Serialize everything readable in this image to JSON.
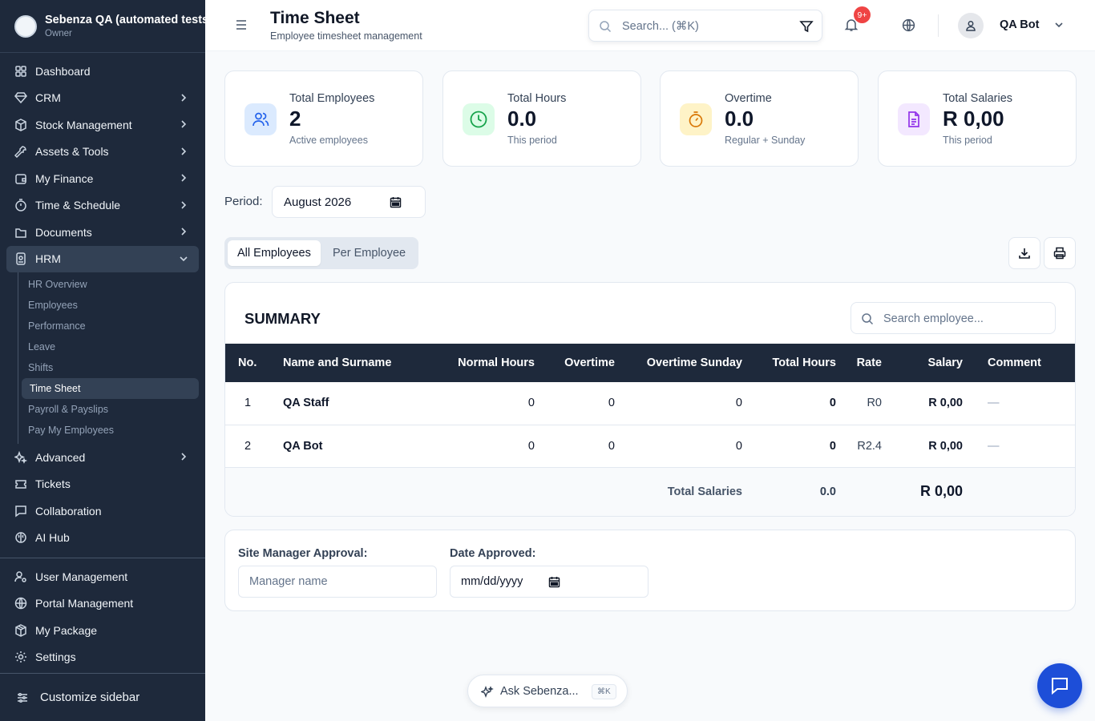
{
  "sidebar": {
    "org_name": "Sebenza QA (automated tests)",
    "role": "Owner",
    "items": [
      {
        "label": "Dashboard",
        "icon": "grid-icon",
        "expandable": false
      },
      {
        "label": "CRM",
        "icon": "gem-icon",
        "expandable": true
      },
      {
        "label": "Stock Management",
        "icon": "box-icon",
        "expandable": true
      },
      {
        "label": "Assets & Tools",
        "icon": "wrench-icon",
        "expandable": true
      },
      {
        "label": "My Finance",
        "icon": "wallet-icon",
        "expandable": true
      },
      {
        "label": "Time & Schedule",
        "icon": "timer-icon",
        "expandable": true
      },
      {
        "label": "Documents",
        "icon": "folder-icon",
        "expandable": true
      },
      {
        "label": "HRM",
        "icon": "id-card-icon",
        "expandable": true,
        "expanded": true
      }
    ],
    "hrm_subitems": [
      "HR Overview",
      "Employees",
      "Performance",
      "Leave",
      "Shifts",
      "Time Sheet",
      "Payroll & Payslips",
      "Pay My Employees"
    ],
    "active_subitem": "Time Sheet",
    "items_after": [
      {
        "label": "Advanced",
        "icon": "sparkles-icon",
        "expandable": true
      },
      {
        "label": "Tickets",
        "icon": "ticket-icon",
        "expandable": false
      },
      {
        "label": "Collaboration",
        "icon": "message-square-icon",
        "expandable": false
      },
      {
        "label": "AI Hub",
        "icon": "brain-icon",
        "expandable": false
      }
    ],
    "bottom_items": [
      {
        "label": "User Management",
        "icon": "user-cog-icon"
      },
      {
        "label": "Portal Management",
        "icon": "globe-icon"
      },
      {
        "label": "My Package",
        "icon": "package-icon"
      },
      {
        "label": "Settings",
        "icon": "gear-icon"
      }
    ],
    "customize_label": "Customize sidebar"
  },
  "header": {
    "title": "Time Sheet",
    "subtitle": "Employee timesheet management",
    "search_placeholder": "Search... (⌘K)",
    "notifications_badge": "9+",
    "user_name": "QA Bot"
  },
  "stats": [
    {
      "label": "Total Employees",
      "value": "2",
      "sub": "Active employees",
      "icon": "users-icon",
      "bg": "#dbeafe",
      "fg": "#2563eb"
    },
    {
      "label": "Total Hours",
      "value": "0.0",
      "sub": "This period",
      "icon": "clock-icon",
      "bg": "#dcfce7",
      "fg": "#16a34a"
    },
    {
      "label": "Overtime",
      "value": "0.0",
      "sub": "Regular + Sunday",
      "icon": "stopwatch-icon",
      "bg": "#fef3c7",
      "fg": "#d97706"
    },
    {
      "label": "Total Salaries",
      "value": "R 0,00",
      "sub": "This period",
      "icon": "document-icon",
      "bg": "#f3e8ff",
      "fg": "#9333ea"
    }
  ],
  "period": {
    "label": "Period:",
    "value": "August  2026"
  },
  "tabs": {
    "all": "All Employees",
    "per": "Per Employee"
  },
  "summary": {
    "title": "SUMMARY",
    "search_placeholder": "Search employee...",
    "columns": [
      "No.",
      "Name and Surname",
      "Normal Hours",
      "Overtime",
      "Overtime Sunday",
      "Total Hours",
      "Rate",
      "Salary",
      "Comment"
    ],
    "rows": [
      {
        "no": "1",
        "name": "QA Staff",
        "normal": "0",
        "overtime": "0",
        "ot_sunday": "0",
        "total": "0",
        "rate": "R0",
        "salary": "R 0,00",
        "comment": "—"
      },
      {
        "no": "2",
        "name": "QA Bot",
        "normal": "0",
        "overtime": "0",
        "ot_sunday": "0",
        "total": "0",
        "rate": "R2.4",
        "salary": "R 0,00",
        "comment": "—"
      }
    ],
    "totals": {
      "label": "Total Salaries",
      "hours": "0.0",
      "salary": "R 0,00"
    }
  },
  "approval": {
    "manager_label": "Site Manager Approval:",
    "manager_placeholder": "Manager name",
    "date_label": "Date Approved:",
    "date_value": "mm/dd/yyyy"
  },
  "ask": {
    "label": "Ask Sebenza...",
    "shortcut": "⌘K"
  }
}
